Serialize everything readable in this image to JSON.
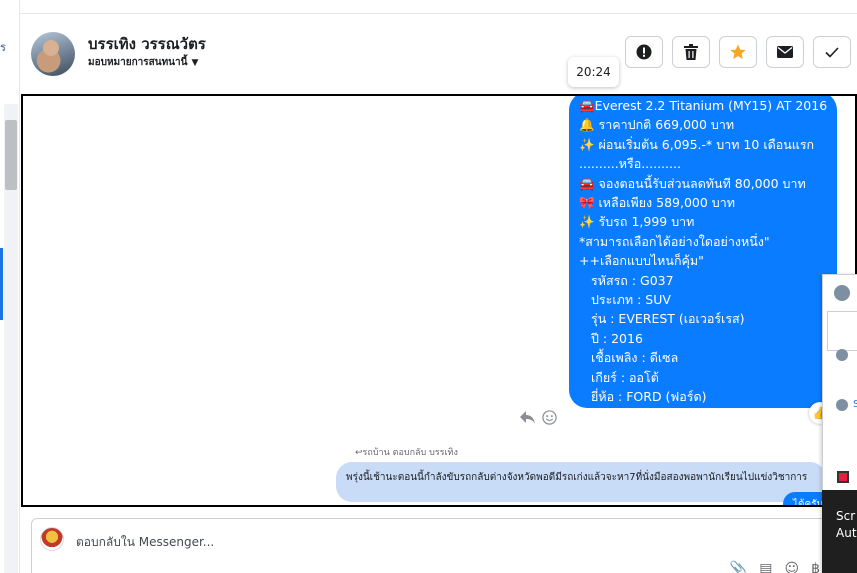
{
  "header": {
    "contact_name": "บรรเทิง วรรณวัตร",
    "assign_label": "มอบหมายการสนทนานี้",
    "actions": [
      {
        "name": "report-button",
        "icon": "!"
      },
      {
        "name": "delete-button",
        "icon": "🗑"
      },
      {
        "name": "star-button",
        "icon": "★"
      },
      {
        "name": "mark-unread-button",
        "icon": "✉"
      },
      {
        "name": "done-button",
        "icon": "✓"
      }
    ]
  },
  "timestamp": "20:24",
  "message": {
    "lines": [
      "🚘Everest 2.2 Titanium (MY15) AT 2016",
      "🔔 ราคาปกติ 669,000 บาท",
      "✨ ผ่อนเริ่มต้น 6,095.-* บาท 10 เดือนแรก",
      "..........หรือ..........",
      "🚘 จองตอนนี้รับส่วนลดทันที 80,000 บาท",
      "🎀  เหลือเพียง 589,000 บาท",
      "✨  รับรถ 1,999 บาท",
      "*สามารถเลือกได้อย่างใดอย่างหนึ่ง\"",
      "++เลือกแบบไหนก็คุ้ม\""
    ],
    "specs": [
      "รหัสรถ : G037",
      "ประเภท : SUV",
      "รุ่น : EVEREST (เอเวอร์เรส)",
      "ปี : 2016",
      "เชื้อเพลิง : ดีเซล",
      "เกียร์ : ออโต้",
      "ยี่ห้อ : FORD (ฟอร์ด)"
    ]
  },
  "reply_note": "↩รถบ้าน ตอบกลับ บรรเทิง",
  "quoted_message": "พรุ่งนี้เช้านะตอนนี้กำลังขับรถกลับต่างจังหวัดพอดีมีรถเก่งแล้วจะหา7ที่นั่งมือสองพอพานักเรียนไปแข่งวิชาการ",
  "tail_text": "ได้ครับ",
  "dark_panel": [
    "Scr",
    "Aut"
  ],
  "composer": {
    "placeholder": "ตอบกลับใน Messenger..."
  }
}
